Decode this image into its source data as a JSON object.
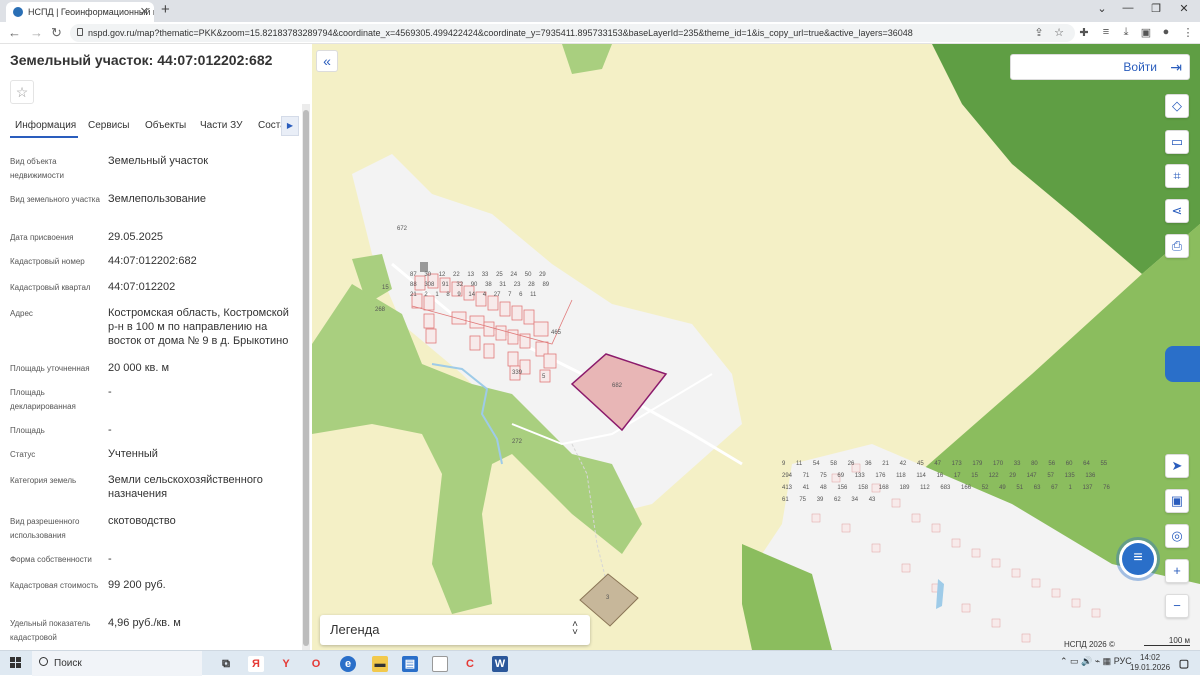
{
  "browser": {
    "tab_title": "НСПД | Геоинформационный п",
    "url": "nspd.gov.ru/map?thematic=PKK&zoom=15.82183783289794&coordinate_x=4569305.499422424&coordinate_y=7935411.895733153&baseLayerId=235&theme_id=1&is_copy_url=true&active_layers=36048"
  },
  "panel": {
    "title": "Земельный участок: 44:07:012202:682",
    "tabs": [
      "Информация",
      "Сервисы",
      "Объекты",
      "Части ЗУ",
      "Соста"
    ],
    "rows": [
      {
        "label": "Вид объекта недвижимости",
        "value": "Земельный участок"
      },
      {
        "label": "Вид земельного участка",
        "value": "Землепользование"
      },
      {
        "label": "Дата присвоения",
        "value": "29.05.2025"
      },
      {
        "label": "Кадастровый номер",
        "value": "44:07:012202:682"
      },
      {
        "label": "Кадастровый квартал",
        "value": "44:07:012202"
      },
      {
        "label": "Адрес",
        "value": "Костромская область, Костромской р-н в 100 м по направлению на восток от дома № 9 в д. Брыкотино"
      },
      {
        "label": "Площадь уточненная",
        "value": "20 000 кв. м"
      },
      {
        "label": "Площадь декларированная",
        "value": "-"
      },
      {
        "label": "Площадь",
        "value": "-"
      },
      {
        "label": "Статус",
        "value": "Учтенный"
      },
      {
        "label": "Категория земель",
        "value": "Земли сельскохозяйственного назначения"
      },
      {
        "label": "Вид разрешенного использования",
        "value": "скотоводство"
      },
      {
        "label": "Форма собственности",
        "value": "-"
      },
      {
        "label": "Кадастровая стоимость",
        "value": "99 200 руб."
      },
      {
        "label": "Удельный показатель кадастровой",
        "value": "4,96 руб./кв. м"
      }
    ]
  },
  "map": {
    "login_label": "Войти",
    "legend_label": "Легенда",
    "attribution": "НСПД 2026 ©",
    "scale_label": "100 м",
    "parcel_labels": {
      "selected": "682",
      "p672": "672",
      "p3": "3",
      "p268": "268",
      "p15": "15",
      "p272": "272",
      "p465": "465",
      "p5": "5",
      "p339": "339"
    },
    "village_numbers": [
      "87",
      "30",
      "12",
      "22",
      "13",
      "33",
      "25",
      "24",
      "50",
      "29",
      "88",
      "308",
      "91",
      "32",
      "90",
      "38",
      "31",
      "23",
      "28",
      "89",
      "21",
      "2",
      "1",
      "8",
      "9",
      "14",
      "4",
      "27",
      "7",
      "6",
      "11"
    ],
    "settlement_numbers": [
      "9",
      "11",
      "54",
      "58",
      "26",
      "36",
      "21",
      "42",
      "45",
      "47",
      "173",
      "179",
      "170",
      "33",
      "80",
      "56",
      "60",
      "64",
      "55",
      "294",
      "71",
      "75",
      "69",
      "133",
      "176",
      "118",
      "114",
      "16",
      "17",
      "15",
      "122",
      "29",
      "147",
      "57",
      "135",
      "136",
      "413",
      "41",
      "48",
      "156",
      "158",
      "168",
      "189",
      "112",
      "683",
      "166",
      "52",
      "49",
      "51",
      "63",
      "67",
      "1",
      "137",
      "76",
      "61",
      "75",
      "39",
      "62",
      "34",
      "43"
    ],
    "colors": {
      "field": "#f4f0c6",
      "forest": "#a9cf7f",
      "forest_dark": "#5f9e44",
      "meadow": "#c3dc8e",
      "settlement": "#f3f3f3",
      "selected_fill": "#e8b6b6",
      "selected_stroke": "#8b1a6b",
      "parcel_stroke": "#e07a7a",
      "accent": "#2a5dbd"
    }
  },
  "taskbar": {
    "search_label": "Поиск",
    "lang": "РУС",
    "time": "14:02",
    "date": "19.01.2026"
  }
}
